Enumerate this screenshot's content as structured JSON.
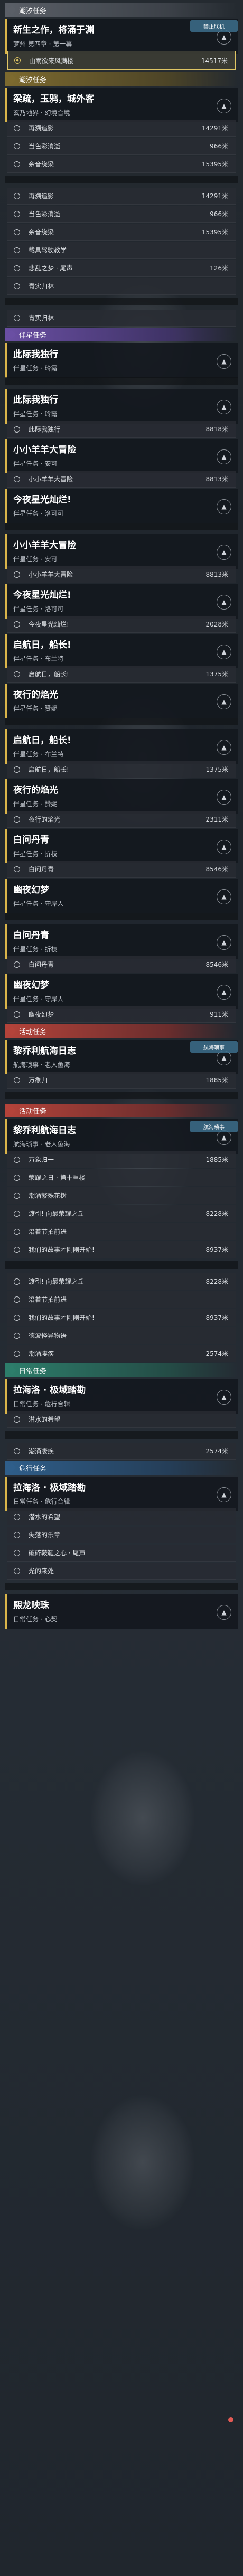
{
  "icons": {
    "expand": "▲",
    "chevron": "▲"
  },
  "section_colors": {
    "gray": "#5a5f67",
    "yellow": "#7d6a2f",
    "purple": "#6a4fa3",
    "red": "#b4433a",
    "green": "#2d7e6b",
    "blue": "#2f5e8a"
  },
  "blocks": [
    {
      "type": "section",
      "tone": "gray",
      "label": "潮汐任务"
    },
    {
      "type": "card",
      "title": "新生之作，将涌于渊",
      "sub": "梦州 第四章 · 第一幕"
    },
    {
      "type": "row",
      "label": "山雨欲来风满楼",
      "dist": "14517米",
      "active": true
    },
    {
      "type": "badge",
      "label": "禁止联机"
    },
    {
      "type": "section",
      "tone": "yellow",
      "label": "潮汐任务"
    },
    {
      "type": "card",
      "title": "梁疏，玉鸦，城外客",
      "sub": "玄乃地界 · 幻境合境"
    },
    {
      "type": "row",
      "label": "再溯追影",
      "dist": "14291米"
    },
    {
      "type": "row",
      "label": "当色彩消逝",
      "dist": "966米"
    },
    {
      "type": "row",
      "label": "余音绕梁",
      "dist": "15395米"
    },
    {
      "type": "gap"
    },
    {
      "type": "row",
      "label": "再溯追影",
      "dist": "14291米"
    },
    {
      "type": "row",
      "label": "当色彩消逝",
      "dist": "966米"
    },
    {
      "type": "row",
      "label": "余音绕梁",
      "dist": "15395米"
    },
    {
      "type": "row",
      "label": "载具驾驶教学",
      "dist": ""
    },
    {
      "type": "row",
      "label": "悲乱之梦 · 尾声",
      "dist": "126米"
    },
    {
      "type": "row",
      "label": "青实归林",
      "dist": ""
    },
    {
      "type": "gap"
    },
    {
      "type": "row",
      "label": "青实归林",
      "dist": ""
    },
    {
      "type": "section",
      "tone": "purple",
      "label": "伴星任务"
    },
    {
      "type": "card",
      "title": "此际我独行",
      "sub": "伴星任务 · 玲霞"
    },
    {
      "type": "gap"
    },
    {
      "type": "card",
      "title": "此际我独行",
      "sub": "伴星任务 · 玲霞"
    },
    {
      "type": "row",
      "label": "此际我独行",
      "dist": "8818米"
    },
    {
      "type": "card",
      "title": "小小羊羊大冒险",
      "sub": "伴星任务 · 安可"
    },
    {
      "type": "row",
      "label": "小小羊羊大冒险",
      "dist": "8813米"
    },
    {
      "type": "card",
      "title": "今夜星光灿烂!",
      "sub": "伴星任务 · 洛可可"
    },
    {
      "type": "gap"
    },
    {
      "type": "card",
      "title": "小小羊羊大冒险",
      "sub": "伴星任务 · 安可"
    },
    {
      "type": "row",
      "label": "小小羊羊大冒险",
      "dist": "8813米"
    },
    {
      "type": "card",
      "title": "今夜星光灿烂!",
      "sub": "伴星任务 · 洛可可"
    },
    {
      "type": "row",
      "label": "今夜星光灿烂!",
      "dist": "2028米"
    },
    {
      "type": "card",
      "title": "启航日，船长!",
      "sub": "伴星任务 · 布兰特"
    },
    {
      "type": "row",
      "label": "启航日，船长!",
      "dist": "1375米"
    },
    {
      "type": "card",
      "title": "夜行的焰光",
      "sub": "伴星任务 · 赞妮"
    },
    {
      "type": "gap"
    },
    {
      "type": "card",
      "title": "启航日，船长!",
      "sub": "伴星任务 · 布兰特"
    },
    {
      "type": "row",
      "label": "启航日，船长!",
      "dist": "1375米"
    },
    {
      "type": "card",
      "title": "夜行的焰光",
      "sub": "伴星任务 · 赞妮"
    },
    {
      "type": "row",
      "label": "夜行的焰光",
      "dist": "2311米"
    },
    {
      "type": "card",
      "title": "白问丹青",
      "sub": "伴星任务 · 折枝"
    },
    {
      "type": "row",
      "label": "白问丹青",
      "dist": "8546米"
    },
    {
      "type": "card",
      "title": "幽夜幻梦",
      "sub": "伴星任务 · 守岸人"
    },
    {
      "type": "gap"
    },
    {
      "type": "card",
      "title": "白问丹青",
      "sub": "伴星任务 · 折枝"
    },
    {
      "type": "row",
      "label": "白问丹青",
      "dist": "8546米"
    },
    {
      "type": "card",
      "title": "幽夜幻梦",
      "sub": "伴星任务 · 守岸人"
    },
    {
      "type": "row",
      "label": "幽夜幻梦",
      "dist": "911米"
    },
    {
      "type": "section",
      "tone": "red",
      "label": "活动任务"
    },
    {
      "type": "card",
      "title": "黎乔利航海日志",
      "sub": "航海琐事 · 老人鱼海"
    },
    {
      "type": "row",
      "label": "万象归一",
      "dist": "1885米"
    },
    {
      "type": "badge",
      "label": "航海琐事"
    },
    {
      "type": "gap"
    },
    {
      "type": "section",
      "tone": "red",
      "label": "活动任务"
    },
    {
      "type": "card",
      "title": "黎乔利航海日志",
      "sub": "航海琐事 · 老人鱼海"
    },
    {
      "type": "row",
      "label": "万象归一",
      "dist": "1885米"
    },
    {
      "type": "badge",
      "label": "航海琐事"
    },
    {
      "type": "row",
      "label": "荣耀之日 · 第十重楼",
      "dist": ""
    },
    {
      "type": "row",
      "label": "潮涌繁殊花树",
      "dist": ""
    },
    {
      "type": "row",
      "label": "渡引! 向最荣耀之丘",
      "dist": "8228米"
    },
    {
      "type": "row",
      "label": "沿着节拍前进",
      "dist": ""
    },
    {
      "type": "row",
      "label": "我们的故事才刚刚开始!",
      "dist": "8937米"
    },
    {
      "type": "gap"
    },
    {
      "type": "row",
      "label": "渡引! 向最荣耀之丘",
      "dist": "8228米"
    },
    {
      "type": "row",
      "label": "沿着节拍前进",
      "dist": ""
    },
    {
      "type": "row",
      "label": "我们的故事才刚刚开始!",
      "dist": "8937米"
    },
    {
      "type": "row",
      "label": "德波怪异物语",
      "dist": ""
    },
    {
      "type": "row",
      "label": "潮涌凄疾",
      "dist": "2574米"
    },
    {
      "type": "section",
      "tone": "green",
      "label": "日常任务"
    },
    {
      "type": "card",
      "title": "拉海洛 · 极域踏勘",
      "sub": "日常任务 · 危行合辑"
    },
    {
      "type": "row",
      "label": "潜水的希望",
      "dist": ""
    },
    {
      "type": "gap"
    },
    {
      "type": "row",
      "label": "潮涌凄疾",
      "dist": "2574米"
    },
    {
      "type": "section",
      "tone": "blue",
      "label": "危行任务"
    },
    {
      "type": "card",
      "title": "拉海洛 · 极域踏勘",
      "sub": "日常任务 · 危行合辑"
    },
    {
      "type": "row",
      "label": "潜水的希望",
      "dist": ""
    },
    {
      "type": "row",
      "label": "失落的乐章",
      "dist": ""
    },
    {
      "type": "row",
      "label": "破碎鞍靼之心 · 尾声",
      "dist": ""
    },
    {
      "type": "row",
      "label": "光的来处",
      "dist": ""
    },
    {
      "type": "gap"
    },
    {
      "type": "card",
      "title": "熙龙映珠",
      "sub": "日常任务 · 心契"
    }
  ],
  "stamps": [
    "禁止联机",
    "航海琐事",
    "德波怪异物语"
  ]
}
